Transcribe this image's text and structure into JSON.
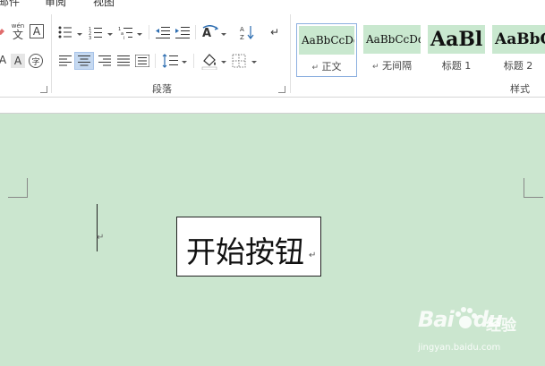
{
  "tabs": {
    "items": [
      {
        "label": "邮件"
      },
      {
        "label": "审阅"
      },
      {
        "label": "视图"
      }
    ]
  },
  "ribbon": {
    "paragraph_group_label": "段落",
    "styles_group_label": "样式",
    "icons": {
      "phonetic": "wén",
      "phonetic_char": "文",
      "boxed_char": "A",
      "enclosed_char": "字",
      "font_letter": "A"
    },
    "styles": [
      {
        "sample": "AaBbCcDd",
        "name": "正文",
        "active": true
      },
      {
        "sample": "AaBbCcDd",
        "name": "无间隔",
        "active": false
      },
      {
        "sample": "AaBl",
        "name": "标题 1",
        "active": false
      },
      {
        "sample": "AaBbC",
        "name": "标题 2",
        "active": false
      }
    ]
  },
  "document": {
    "textbox_text": "开始按钮",
    "paragraph_mark": "↵"
  },
  "watermark": {
    "brand": "Bai",
    "brand_suffix": "du",
    "product": "经验",
    "url": "jingyan.baidu.com"
  },
  "colors": {
    "document_background": "#cbe6cf",
    "style_sample_background": "#c9e8cf",
    "selected_button": "#c5d9f1"
  }
}
